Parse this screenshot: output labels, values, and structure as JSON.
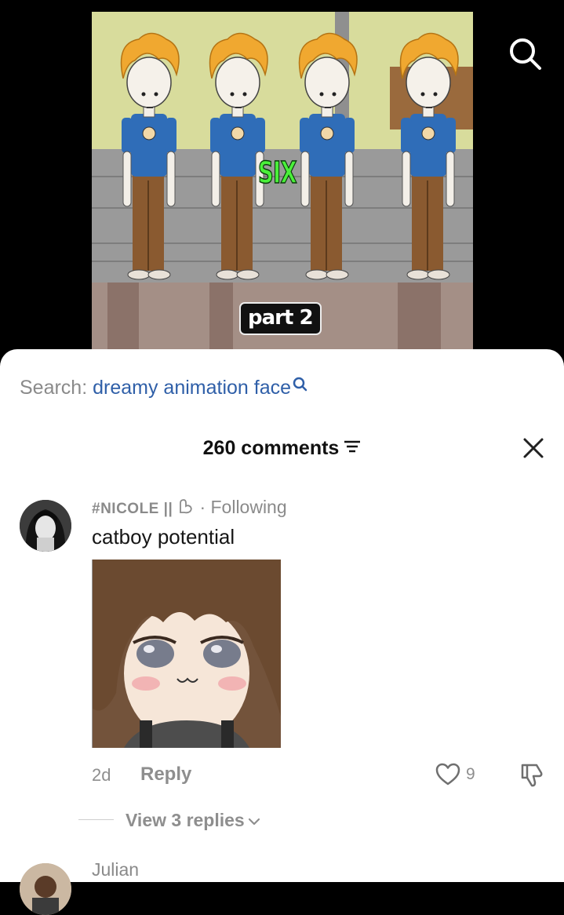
{
  "video": {
    "caption_main": "SIX",
    "caption_sub": "part 2"
  },
  "icons": {
    "top_search": "search-icon",
    "close": "close-icon",
    "filter": "filter-icon",
    "like": "heart-icon",
    "dislike": "thumbs-down-icon",
    "chevron": "chevron-down-icon"
  },
  "search_suggestion": {
    "prefix": "Search:",
    "term": "dreamy animation face"
  },
  "comments_header": {
    "count_label": "260 comments"
  },
  "comments": [
    {
      "username": "#NICOLE || ",
      "following": "· Following",
      "text": "catboy potential",
      "time": "2d",
      "reply_label": "Reply",
      "likes": "9",
      "view_replies": "View 3 replies"
    },
    {
      "username": "Julian"
    }
  ],
  "colors": {
    "accent_link": "#2f5fa8",
    "muted_text": "#8a8a8a",
    "sheet_bg": "#ffffff"
  }
}
